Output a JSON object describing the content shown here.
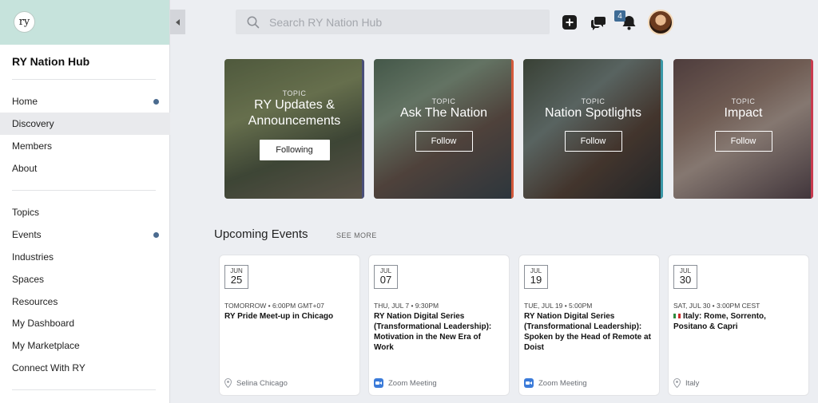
{
  "sidebar": {
    "logo": "ry",
    "title": "RY Nation Hub",
    "group1": [
      {
        "label": "Home",
        "dot": true
      },
      {
        "label": "Discovery",
        "active": true
      },
      {
        "label": "Members"
      },
      {
        "label": "About"
      }
    ],
    "group2": [
      {
        "label": "Topics"
      },
      {
        "label": "Events",
        "dot": true
      },
      {
        "label": "Industries"
      },
      {
        "label": "Spaces"
      },
      {
        "label": "Resources"
      },
      {
        "label": "My Dashboard"
      },
      {
        "label": "My Marketplace"
      },
      {
        "label": "Connect With RY"
      }
    ]
  },
  "header": {
    "search_placeholder": "Search RY Nation Hub",
    "notifications_count": "4"
  },
  "topics": [
    {
      "label": "TOPIC",
      "name": "RY Updates & Announcements",
      "button": "Following",
      "following": true,
      "bg": "#6c7a59",
      "edge": "#4a4f7a"
    },
    {
      "label": "TOPIC",
      "name": "Ask The Nation",
      "button": "Follow",
      "following": false,
      "bg": "#6a7c6e",
      "edge": "#d45a3c"
    },
    {
      "label": "TOPIC",
      "name": "Nation Spotlights",
      "button": "Follow",
      "following": false,
      "bg": "#5d6b6c",
      "edge": "#3a98a8"
    },
    {
      "label": "TOPIC",
      "name": "Impact",
      "button": "Follow",
      "following": false,
      "bg": "#7a5c57",
      "edge": "#c93b4f"
    }
  ],
  "events_section": {
    "title": "Upcoming Events",
    "see_more": "SEE MORE"
  },
  "events": [
    {
      "month": "JUN",
      "day": "25",
      "when": "TOMORROW • 6:00PM GMT+07",
      "title": "RY Pride Meet-up in Chicago",
      "location": "Selina Chicago",
      "loc_type": "pin"
    },
    {
      "month": "JUL",
      "day": "07",
      "when": "THU, JUL 7 • 9:30PM",
      "title": "RY Nation Digital Series (Transformational Leadership): Motivation in the New Era of Work",
      "location": "Zoom Meeting",
      "loc_type": "zoom"
    },
    {
      "month": "JUL",
      "day": "19",
      "when": "TUE, JUL 19 • 5:00PM",
      "title": "RY Nation Digital Series (Transformational Leadership): Spoken by the Head of Remote at Doist",
      "location": "Zoom Meeting",
      "loc_type": "zoom"
    },
    {
      "month": "JUL",
      "day": "30",
      "when": "SAT, JUL 30 • 3:00PM CEST",
      "title": "Italy: Rome, Sorrento, Positano & Capri",
      "location": "Italy",
      "loc_type": "pin",
      "flag": true
    }
  ]
}
